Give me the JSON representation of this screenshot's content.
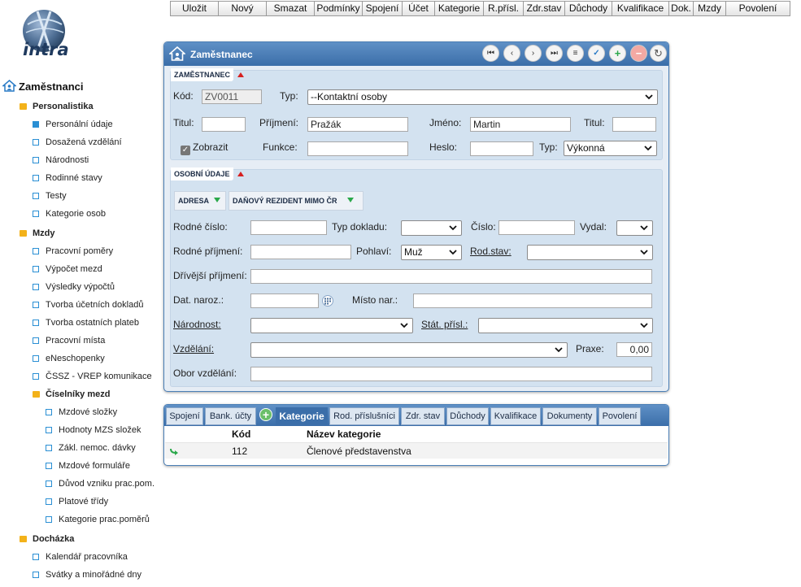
{
  "toolbar": [
    {
      "label": "Uložit"
    },
    {
      "label": "Nový"
    },
    {
      "label": "Smazat"
    },
    {
      "label": "Podmínky"
    },
    {
      "label": "Spojení"
    },
    {
      "label": "Účet"
    },
    {
      "label": "Kategorie"
    },
    {
      "label": "R.přísl."
    },
    {
      "label": "Zdr.stav"
    },
    {
      "label": "Důchody"
    },
    {
      "label": "Kvalifikace"
    },
    {
      "label": "Dok."
    },
    {
      "label": "Mzdy"
    },
    {
      "label": "Povolení"
    }
  ],
  "logo": {
    "text": "intra"
  },
  "sidebar": {
    "root": "Zaměstnanci",
    "personalistika": {
      "label": "Personalistika",
      "items": [
        "Personální údaje",
        "Dosažená vzdělání",
        "Národnosti",
        "Rodinné stavy",
        "Testy",
        "Kategorie osob"
      ]
    },
    "mzdy": {
      "label": "Mzdy",
      "items": [
        "Pracovní poměry",
        "Výpočet mezd",
        "Výsledky výpočtů",
        "Tvorba účetních dokladů",
        "Tvorba ostatních plateb",
        "Pracovní místa",
        "eNeschopenky",
        "ČSSZ - VREP komunikace"
      ]
    },
    "ciselniky": {
      "label": "Číselníky mezd",
      "items": [
        "Mzdové složky",
        "Hodnoty MZS složek",
        "Zákl. nemoc. dávky",
        "Mzdové formuláře",
        "Důvod vzniku prac.pom.",
        "Platové třídy",
        "Kategorie prac.poměrů"
      ]
    },
    "dochazka": {
      "label": "Docházka",
      "items": [
        "Kalendář pracovníka",
        "Svátky a minořádné dny"
      ]
    },
    "selected": "Personální údaje"
  },
  "panel": {
    "title": "Zaměstnanec",
    "nav_icons": [
      "first-icon",
      "prev-icon",
      "next-icon",
      "last-icon",
      "list-icon",
      "check-icon",
      "add-icon",
      "remove-icon",
      "refresh-icon"
    ]
  },
  "zamestnanec": {
    "section_label": "ZAMĚSTNANEC",
    "kod_label": "Kód:",
    "kod_value": "ZV0011",
    "typ_label": "Typ:",
    "typ_value": "--Kontaktní osoby",
    "titul_label": "Titul:",
    "titul_value": "",
    "prijmeni_label": "Příjmení:",
    "prijmeni_value": "Pražák",
    "jmeno_label": "Jméno:",
    "jmeno_value": "Martin",
    "titul2_label": "Titul:",
    "titul2_value": "",
    "zobrazit_label": "Zobrazit",
    "zobrazit_checked": true,
    "funkce_label": "Funkce:",
    "funkce_value": "",
    "heslo_label": "Heslo:",
    "heslo_value": "",
    "typ2_label": "Typ:",
    "typ2_value": "Výkonná"
  },
  "osobni": {
    "section_label": "OSOBNÍ ÚDAJE",
    "subtabs": [
      "ADRESA",
      "DAŇOVÝ REZIDENT MIMO ČR"
    ],
    "rodne_cislo_label": "Rodné číslo:",
    "rodne_cislo_value": "",
    "typ_dokladu_label": "Typ dokladu:",
    "typ_dokladu_value": "",
    "cislo_label": "Číslo:",
    "cislo_value": "",
    "vydal_label": "Vydal:",
    "vydal_value": "",
    "rodne_prijmeni_label": "Rodné příjmení:",
    "rodne_prijmeni_value": "",
    "pohlavi_label": "Pohlaví:",
    "pohlavi_value": "Muž",
    "rod_stav_label": "Rod.stav:",
    "rod_stav_value": "",
    "drivejsi_label": "Dřívější příjmení:",
    "drivejsi_value": "",
    "dat_naroz_label": "Dat. naroz.:",
    "dat_naroz_value": "",
    "misto_nar_label": "Místo nar.:",
    "misto_nar_value": "",
    "narodnost_label": "Národnost:",
    "narodnost_value": "",
    "stat_prisl_label": "Stát. přísl.:",
    "stat_prisl_value": "",
    "vzdelani_label": "Vzdělání:",
    "vzdelani_value": "",
    "praxe_label": "Praxe:",
    "praxe_value": "0,00",
    "obor_label": "Obor vzdělání:",
    "obor_value": ""
  },
  "bottom": {
    "tabs": [
      "Spojení",
      "Bank. účty",
      "Kategorie",
      "Rod. příslušníci",
      "Zdr. stav",
      "Důchody",
      "Kvalifikace",
      "Dokumenty",
      "Povolení"
    ],
    "active_tab": "Kategorie",
    "col_kod": "Kód",
    "col_nazev": "Název kategorie",
    "rows": [
      {
        "kod": "112",
        "nazev": "Členové představenstva"
      }
    ]
  },
  "colors": {
    "accent": "#3b6ea9",
    "folder": "#f3b21a",
    "tree": "#2a8fd4"
  }
}
